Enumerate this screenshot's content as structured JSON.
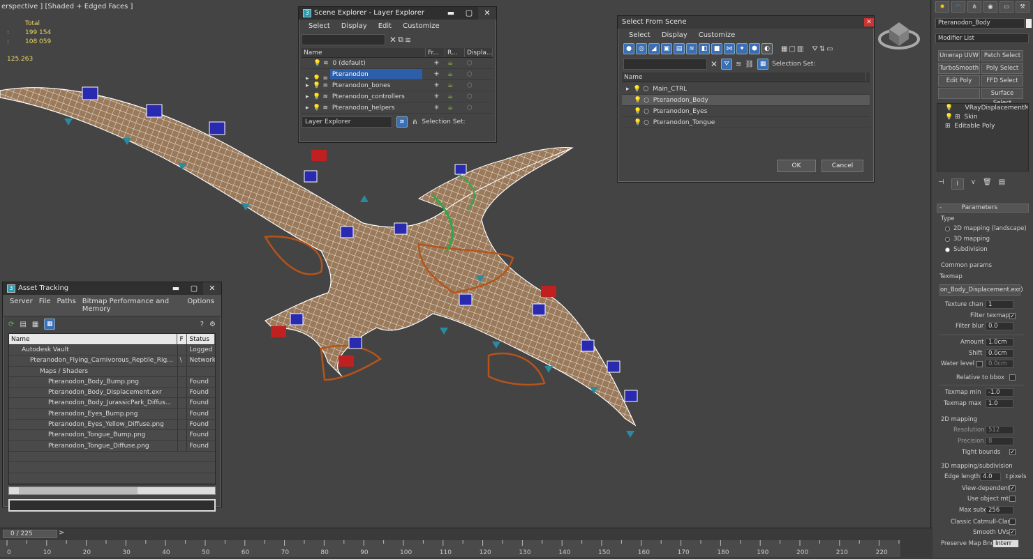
{
  "viewport": {
    "label": "erspective ] [Shaded + Edged Faces ]",
    "stats": {
      "total_label": "Total",
      "polys_label": ":",
      "polys": "199 154",
      "verts_label": ":",
      "verts": "108 059",
      "fps": "125.263"
    }
  },
  "scene_explorer": {
    "title": "Scene Explorer - Layer Explorer",
    "menu": [
      "Select",
      "Display",
      "Edit",
      "Customize"
    ],
    "columns": [
      "Name",
      "Fr...",
      "R...",
      "Displa..."
    ],
    "rows": [
      "0 (default)",
      "Pteranodon",
      "Pteranodon_bones",
      "Pteranodon_controllers",
      "Pteranodon_helpers"
    ],
    "footer_dropdown": "Layer Explorer",
    "selection_set_label": "Selection Set:"
  },
  "select_from_scene": {
    "title": "Select From Scene",
    "menu": [
      "Select",
      "Display",
      "Customize"
    ],
    "selection_set_label": "Selection Set:",
    "column": "Name",
    "rows": [
      "Main_CTRL",
      "Pteranodon_Body",
      "Pteranodon_Eyes",
      "Pteranodon_Tongue"
    ],
    "ok": "OK",
    "cancel": "Cancel"
  },
  "asset_tracking": {
    "title": "Asset Tracking",
    "menu": [
      "Server",
      "File",
      "Paths",
      "Bitmap Performance and Memory",
      "Options"
    ],
    "columns": [
      "Name",
      "F",
      "Status"
    ],
    "rows": [
      {
        "name": "Autodesk Vault",
        "f": "",
        "status": "Logged"
      },
      {
        "name": "Pteranodon_Flying_Carnivorous_Reptile_Rig...",
        "f": "\\",
        "status": "Network"
      },
      {
        "name": "Maps / Shaders",
        "f": "",
        "status": ""
      },
      {
        "name": "Pteranodon_Body_Bump.png",
        "f": "",
        "status": "Found"
      },
      {
        "name": "Pteranodon_Body_Displacement.exr",
        "f": "",
        "status": "Found"
      },
      {
        "name": "Pteranodon_Body_JurassicPark_Diffus...",
        "f": "",
        "status": "Found"
      },
      {
        "name": "Pteranodon_Eyes_Bump.png",
        "f": "",
        "status": "Found"
      },
      {
        "name": "Pteranodon_Eyes_Yellow_Diffuse.png",
        "f": "",
        "status": "Found"
      },
      {
        "name": "Pteranodon_Tongue_Bump.png",
        "f": "",
        "status": "Found"
      },
      {
        "name": "Pteranodon_Tongue_Diffuse.png",
        "f": "",
        "status": "Found"
      }
    ]
  },
  "command_panel": {
    "object_name": "Pteranodon_Body",
    "modifier_list": "Modifier List",
    "buttons": [
      "Unwrap UVW",
      "Patch Select",
      "TurboSmooth",
      "Poly Select",
      "Edit Poly",
      "FFD Select",
      "",
      "Surface Select"
    ],
    "stack": [
      "VRayDisplacementMod",
      "Skin",
      "Editable Poly"
    ],
    "rollout": "Parameters",
    "type_label": "Type",
    "type_options": [
      "2D mapping (landscape)",
      "3D mapping",
      "Subdivision"
    ],
    "common_params": "Common params",
    "texmap_label": "Texmap",
    "texmap_value": "on_Body_Displacement.exr)",
    "texture_chan_label": "Texture chan",
    "texture_chan": "1",
    "filter_texmap_label": "Filter texmap",
    "filter_blur_label": "Filter blur",
    "filter_blur": "0.0",
    "amount_label": "Amount",
    "amount": "1.0cm",
    "shift_label": "Shift",
    "shift": "0.0cm",
    "water_level_label": "Water level",
    "water_level": "0.0cm",
    "relative_bbox_label": "Relative to bbox",
    "texmap_min_label": "Texmap min",
    "texmap_min": "-1.0",
    "texmap_max_label": "Texmap max",
    "texmap_max": "1.0",
    "mapping2d_label": "2D mapping",
    "resolution_label": "Resolution",
    "resolution": "512",
    "precision_label": "Precision",
    "precision": "8",
    "tight_bounds_label": "Tight bounds",
    "mapping3d_label": "3D mapping/subdivision",
    "edge_length_label": "Edge length",
    "edge_length": "4.0",
    "pixels_label": "pixels",
    "view_dependent_label": "View-dependent",
    "use_object_mtl_label": "Use object mtl",
    "max_subdivs_label": "Max subdivs",
    "max_subdivs": "256",
    "classic_label": "Classic Catmull-Clark",
    "smooth_uvs_label": "Smooth UVs",
    "preserve_map_label": "Preserve Map Bnd",
    "preserve_map": "Interr"
  },
  "timeline": {
    "frame": "0 / 225",
    "ticks": [
      "0",
      "10",
      "20",
      "30",
      "40",
      "50",
      "60",
      "70",
      "80",
      "90",
      "100",
      "110",
      "120",
      "130",
      "140",
      "150",
      "160",
      "170",
      "180",
      "190",
      "200",
      "210",
      "220"
    ]
  }
}
